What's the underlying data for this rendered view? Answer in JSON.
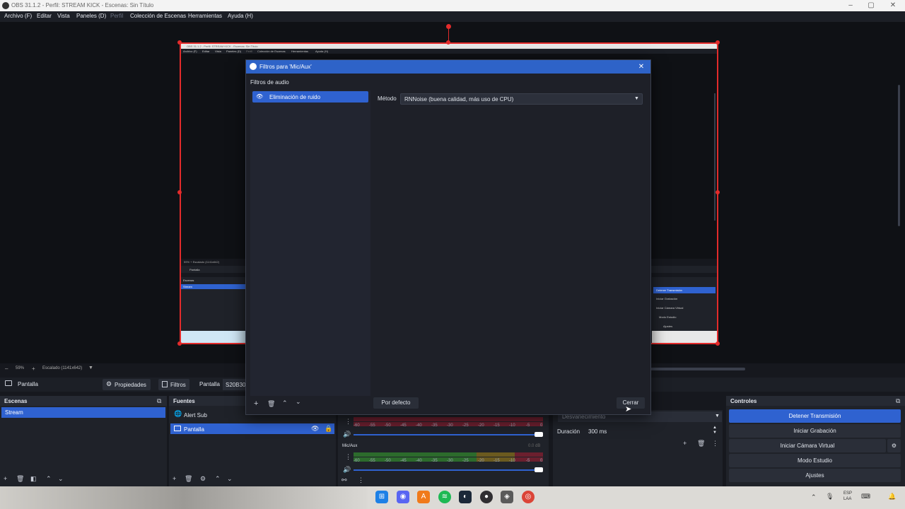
{
  "window": {
    "title": "OBS 31.1.2 - Perfil: STREAM KICK - Escenas: Sin Título"
  },
  "menu": [
    {
      "label": "Archivo (F)",
      "dim": false
    },
    {
      "label": "Editar",
      "dim": false
    },
    {
      "label": "Vista",
      "dim": false
    },
    {
      "label": "Paneles (D)",
      "dim": false
    },
    {
      "label": "Perfil",
      "dim": true
    },
    {
      "label": "Colección de Escenas",
      "dim": false
    },
    {
      "label": "Herramientas",
      "dim": false
    },
    {
      "label": "Ayuda (H)",
      "dim": false
    }
  ],
  "preview": {
    "mini_title": "OBS 31.1.2 - Perfil: STREAM KICK - Escenas: Sin Título",
    "mini_menu": [
      "Archivo (F)",
      "Editar",
      "Vista",
      "Paneles (D)",
      "Perfil",
      "Colección de Escenas",
      "Herramientas",
      "Ayuda (H)"
    ],
    "mini_zoom": "59%  +  Escalado (1141x642)",
    "mini_source": "Pantalla",
    "mini_scenes_title": "Escenas",
    "mini_scene": "Stream",
    "mini_controls": [
      "Detener Transmisión",
      "Iniciar Grabación",
      "Iniciar Cámara Virtual",
      "Modo Estudio",
      "Ajustes"
    ]
  },
  "zoom": {
    "percent": "59%",
    "plus": "+",
    "scale": "Escalado (1141x642)"
  },
  "source_toolbar": {
    "source": "Pantalla",
    "properties": "Propiedades",
    "filters": "Filtros",
    "source_label": "Pantalla",
    "display": "S20B300"
  },
  "scenes": {
    "title": "Escenas",
    "items": [
      "Stream"
    ]
  },
  "sources": {
    "title": "Fuentes",
    "items": [
      {
        "label": "Alert Sub",
        "icon": "globe-icon"
      },
      {
        "label": "Pantalla",
        "icon": "monitor-icon"
      }
    ]
  },
  "mixer": {
    "ticks": [
      "-60",
      "-55",
      "-50",
      "-45",
      "-40",
      "-35",
      "-30",
      "-25",
      "-20",
      "-15",
      "-10",
      "-5",
      "0"
    ],
    "channel2_name": "Mic/Aux",
    "channel2_db": "0.0 dB"
  },
  "transitions": {
    "type": "Desvanecimiento",
    "duration_label": "Duración",
    "duration_value": "300 ms"
  },
  "controls": {
    "title": "Controles",
    "buttons": [
      "Detener Transmisión",
      "Iniciar Grabación",
      "Iniciar Cámara Virtual",
      "Modo Estudio",
      "Ajustes"
    ]
  },
  "dialog": {
    "title": "Filtros para 'Mic/Aux'",
    "section": "Filtros de audio",
    "filters": [
      "Eliminación de ruido"
    ],
    "method_label": "Método",
    "method_value": "RNNoise (buena calidad, más uso de CPU)",
    "default_button": "Por defecto",
    "close_button": "Cerrar"
  },
  "tray": {
    "lang1": "ESP",
    "lang2": "LAA"
  },
  "colors": {
    "accent": "#2f62d0",
    "title_accent": "#2e63c8",
    "red": "#e32b2b",
    "panel": "#1f2229"
  }
}
